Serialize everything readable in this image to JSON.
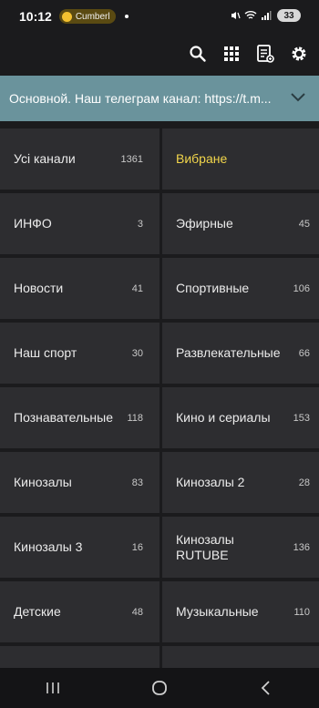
{
  "status": {
    "time": "10:12",
    "media_label": "Cumberl",
    "battery": "33"
  },
  "toolbar": {
    "icons": [
      "search-icon",
      "grid-icon",
      "playlist-icon",
      "settings-icon"
    ]
  },
  "group": {
    "label": "Основной. Наш телеграм канал: https://t.m..."
  },
  "categories": [
    {
      "name": "Усі канали",
      "count": "1361"
    },
    {
      "name": "Вибране",
      "count": ""
    },
    {
      "name": "ИНФО",
      "count": "3"
    },
    {
      "name": "Эфирные",
      "count": "45"
    },
    {
      "name": "Новости",
      "count": "41"
    },
    {
      "name": "Спортивные",
      "count": "106"
    },
    {
      "name": "Наш спорт",
      "count": "30"
    },
    {
      "name": "Развлекательные",
      "count": "66"
    },
    {
      "name": "Познавательные",
      "count": "118"
    },
    {
      "name": "Кино и сериалы",
      "count": "153"
    },
    {
      "name": "Кинозалы",
      "count": "83"
    },
    {
      "name": "Кинозалы 2",
      "count": "28"
    },
    {
      "name": "Кинозалы 3",
      "count": "16"
    },
    {
      "name": "Кинозалы RUTUBE",
      "count": "136"
    },
    {
      "name": "Детские",
      "count": "48"
    },
    {
      "name": "Музыкальные",
      "count": "110"
    }
  ],
  "colors": {
    "group_bar": "#6a939c",
    "favorite_label": "#f2d64b",
    "tile": "#2d2d30",
    "background": "#1b1b1d"
  }
}
